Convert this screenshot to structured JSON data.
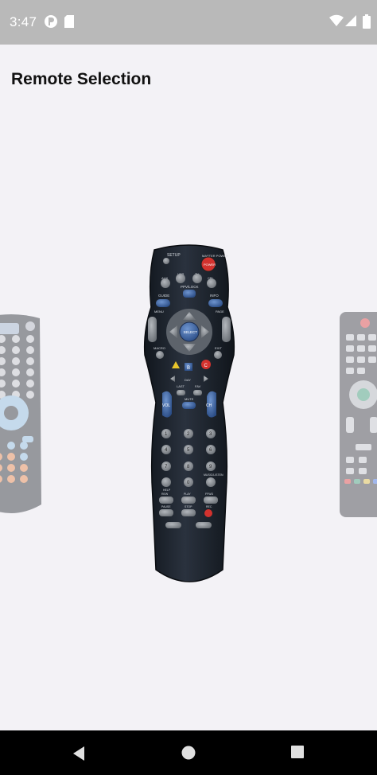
{
  "status_bar": {
    "time": "3:47",
    "icons": [
      "p-badge-icon",
      "sd-card-icon",
      "wifi-icon",
      "signal-icon",
      "battery-icon"
    ]
  },
  "app_bar": {
    "title": "Remote Selection"
  },
  "carousel": {
    "items": [
      {
        "name": "remote-left-preview"
      },
      {
        "name": "remote-center-selected"
      },
      {
        "name": "remote-right-preview"
      }
    ]
  },
  "remote_labels": {
    "setup": "SETUP",
    "master_power": "MASTER POWER",
    "power": "POWER",
    "aux": "AUX",
    "vcr": "VCR",
    "tv": "TV",
    "cbl": "CBL",
    "ppv_lock": "PPV/LOCK",
    "guide": "GUIDE",
    "info": "INFO",
    "menu": "MENU",
    "page": "PAGE",
    "select": "SELECT",
    "macro": "MACRO",
    "exit": "EXIT",
    "b": "B",
    "c": "C",
    "day": "DAY",
    "last": "LAST",
    "fav": "FAV",
    "mute": "MUTE",
    "vol": "VOL",
    "ch": "CH",
    "digits": [
      "1",
      "2",
      "3",
      "4",
      "5",
      "6",
      "7",
      "8",
      "9",
      "0"
    ],
    "help": "HELP",
    "music": "MUSIC/LISTEN",
    "rew": "REW",
    "play": "PLAY",
    "ffwd": "FFWD",
    "pause": "PAUSE",
    "stop": "STOP",
    "rec": "REC"
  },
  "colors": {
    "status_bar_bg": "#b9b9b9",
    "content_bg": "#f3f2f6",
    "remote_body": "#1e2530",
    "remote_button_gray": "#8a8e94",
    "remote_button_blue": "#3c5f9c",
    "power_red": "#d3322e"
  },
  "nav_bar": {
    "back": "back-icon",
    "home": "home-icon",
    "recents": "recents-icon"
  }
}
